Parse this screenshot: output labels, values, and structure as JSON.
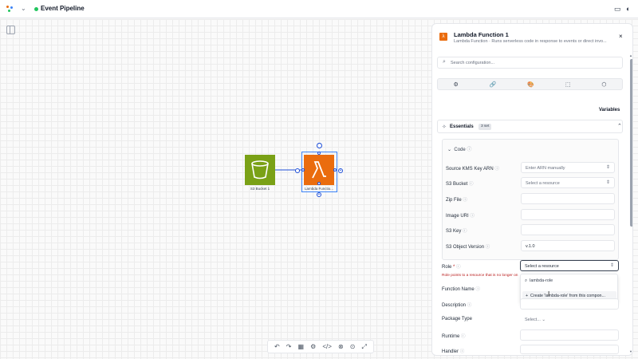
{
  "header": {
    "title": "Event Pipeline",
    "dropdown_icon": "chevron-down-icon",
    "icons": [
      "keyboard-icon",
      "theme-icon"
    ]
  },
  "canvas": {
    "nodes": [
      {
        "label": "S3 Bucket 1",
        "color": "#7aa116",
        "icon": "bucket-icon"
      },
      {
        "label": "Lambda Functio...",
        "color": "#ea6c0e",
        "icon": "lambda-icon"
      }
    ],
    "toolbar": [
      "↶",
      "↷",
      "▦",
      "⚙",
      "</>",
      "⊗",
      "⊙",
      "⤢"
    ]
  },
  "panel": {
    "title": "Lambda Function 1",
    "subtitle": "Lambda Function · Runs serverless code in response to events or direct invo...",
    "close": "×",
    "search_placeholder": "Search configuration...",
    "tabs": [
      "⚙",
      "🔗",
      "🎨",
      "⬚",
      "⬡"
    ],
    "variables_label": "Variables",
    "essentials": {
      "label": "Essentials",
      "badge": "3 set",
      "chevron": "⌃"
    },
    "code_section": {
      "heading": "Code",
      "fields": [
        {
          "label": "Source KMS Key ARN",
          "value": "Enter ARN manually",
          "kind": "select"
        },
        {
          "label": "S3 Bucket",
          "value": "Select a resource",
          "kind": "select"
        },
        {
          "label": "Zip File",
          "value": "",
          "kind": "input"
        },
        {
          "label": "Image URI",
          "value": "",
          "kind": "input"
        },
        {
          "label": "S3 Key",
          "value": "",
          "kind": "input"
        },
        {
          "label": "S3 Object Version",
          "value": "v.1.0",
          "kind": "input"
        }
      ]
    },
    "role": {
      "label": "Role",
      "required": "*",
      "value": "Select a resource",
      "error": "Role points to a resource that is no longer on",
      "dropdown": {
        "search_value": "lambda-role",
        "create_option": "Create 'lambda-role' from this compon..."
      }
    },
    "fields": [
      {
        "label": "Function Name",
        "value": ""
      },
      {
        "label": "Description",
        "value": ""
      },
      {
        "label": "Package Type",
        "value": "Select..."
      },
      {
        "label": "Runtime",
        "value": ""
      },
      {
        "label": "Handler",
        "value": ""
      }
    ]
  }
}
